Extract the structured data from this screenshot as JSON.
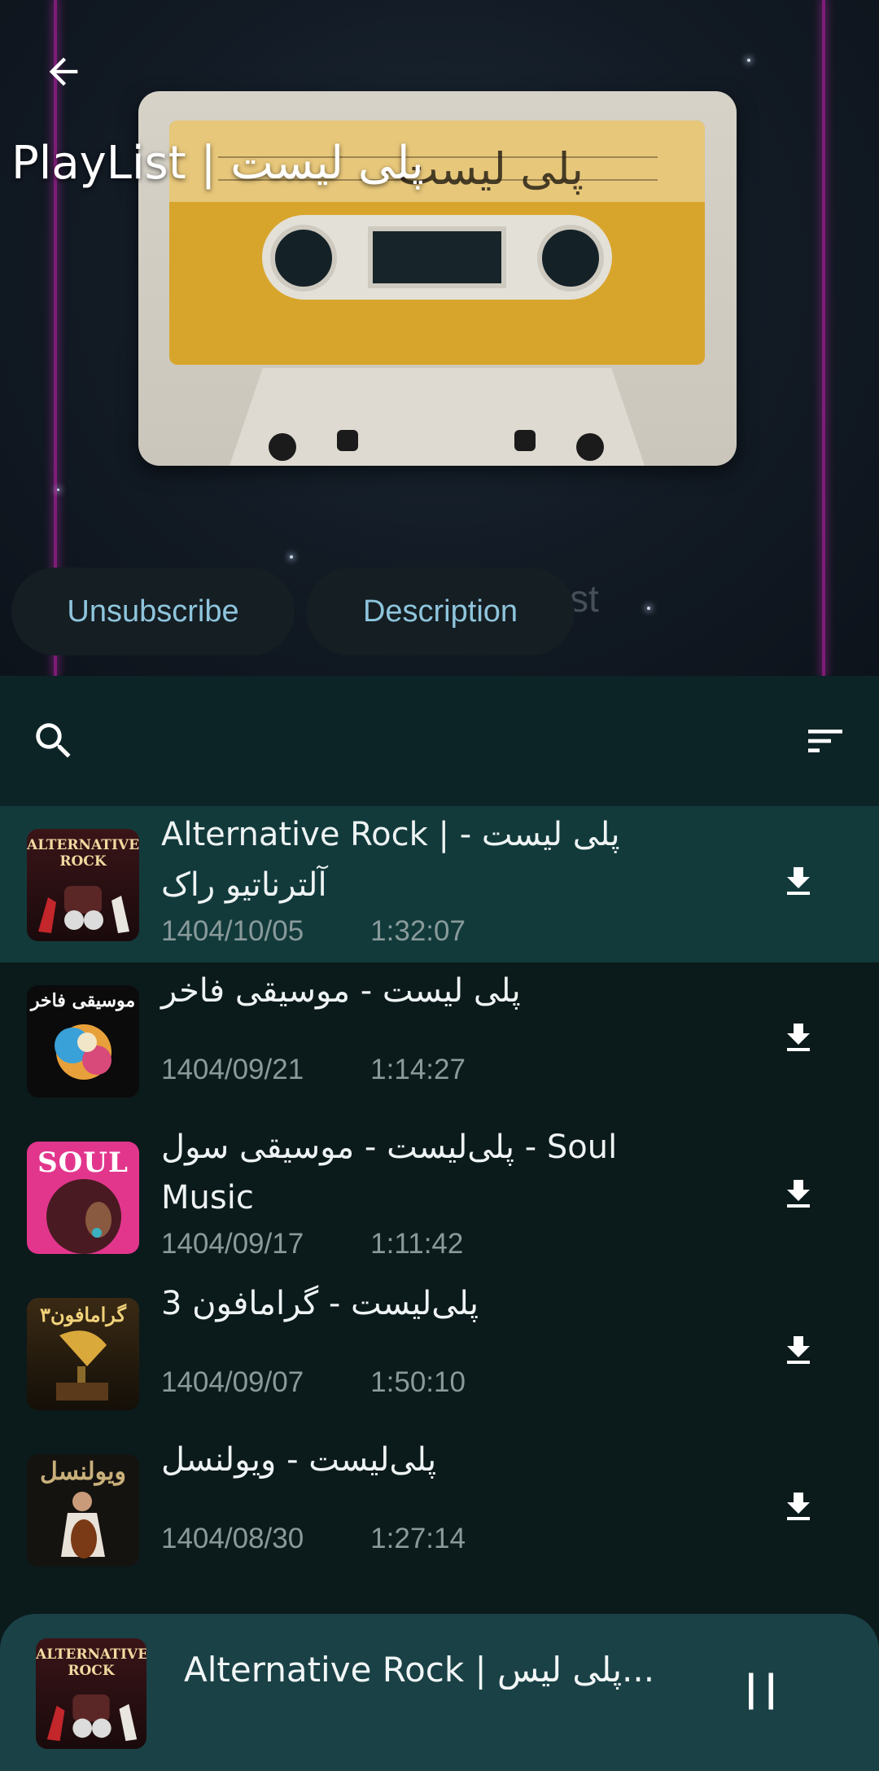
{
  "header": {
    "title": "PlayList | پلی لیست",
    "cassette_label": "پلی لیست",
    "faded_text": "st"
  },
  "actions": {
    "unsubscribe_label": "Unsubscribe",
    "description_label": "Description"
  },
  "toolbar": {
    "search_icon": "search-icon",
    "sort_icon": "sort-icon"
  },
  "tracks": [
    {
      "title": "Alternative Rock | - پلی لیست\nآلترناتیو راک",
      "date": "1404/10/05",
      "duration": "1:32:07",
      "art": "ALTERNATIVE ROCK",
      "active": true
    },
    {
      "title": "پلی لیست - موسیقی فاخر",
      "date": "1404/09/21",
      "duration": "1:14:27",
      "art": "موسیقی فاخر",
      "active": false
    },
    {
      "title": "پلی‌لیست - موسیقی سول - Soul\nMusic",
      "date": "1404/09/17",
      "duration": "1:11:42",
      "art": "SOUL",
      "active": false
    },
    {
      "title": "پلی‌لیست - گرامافون 3",
      "date": "1404/09/07",
      "duration": "1:50:10",
      "art": "گرامافون۳",
      "active": false
    },
    {
      "title": "پلی‌لیست - ویولنسل",
      "date": "1404/08/30",
      "duration": "1:27:14",
      "art": "ویولنسل",
      "active": false
    }
  ],
  "player": {
    "title": "Alternative Rock | پلی لیس...",
    "art": "ALTERNATIVE ROCK",
    "state_icon": "pause-icon"
  },
  "colors": {
    "accent": "#8ec5dd",
    "active_row": "#123a3b",
    "player_bg": "#1a4146"
  }
}
